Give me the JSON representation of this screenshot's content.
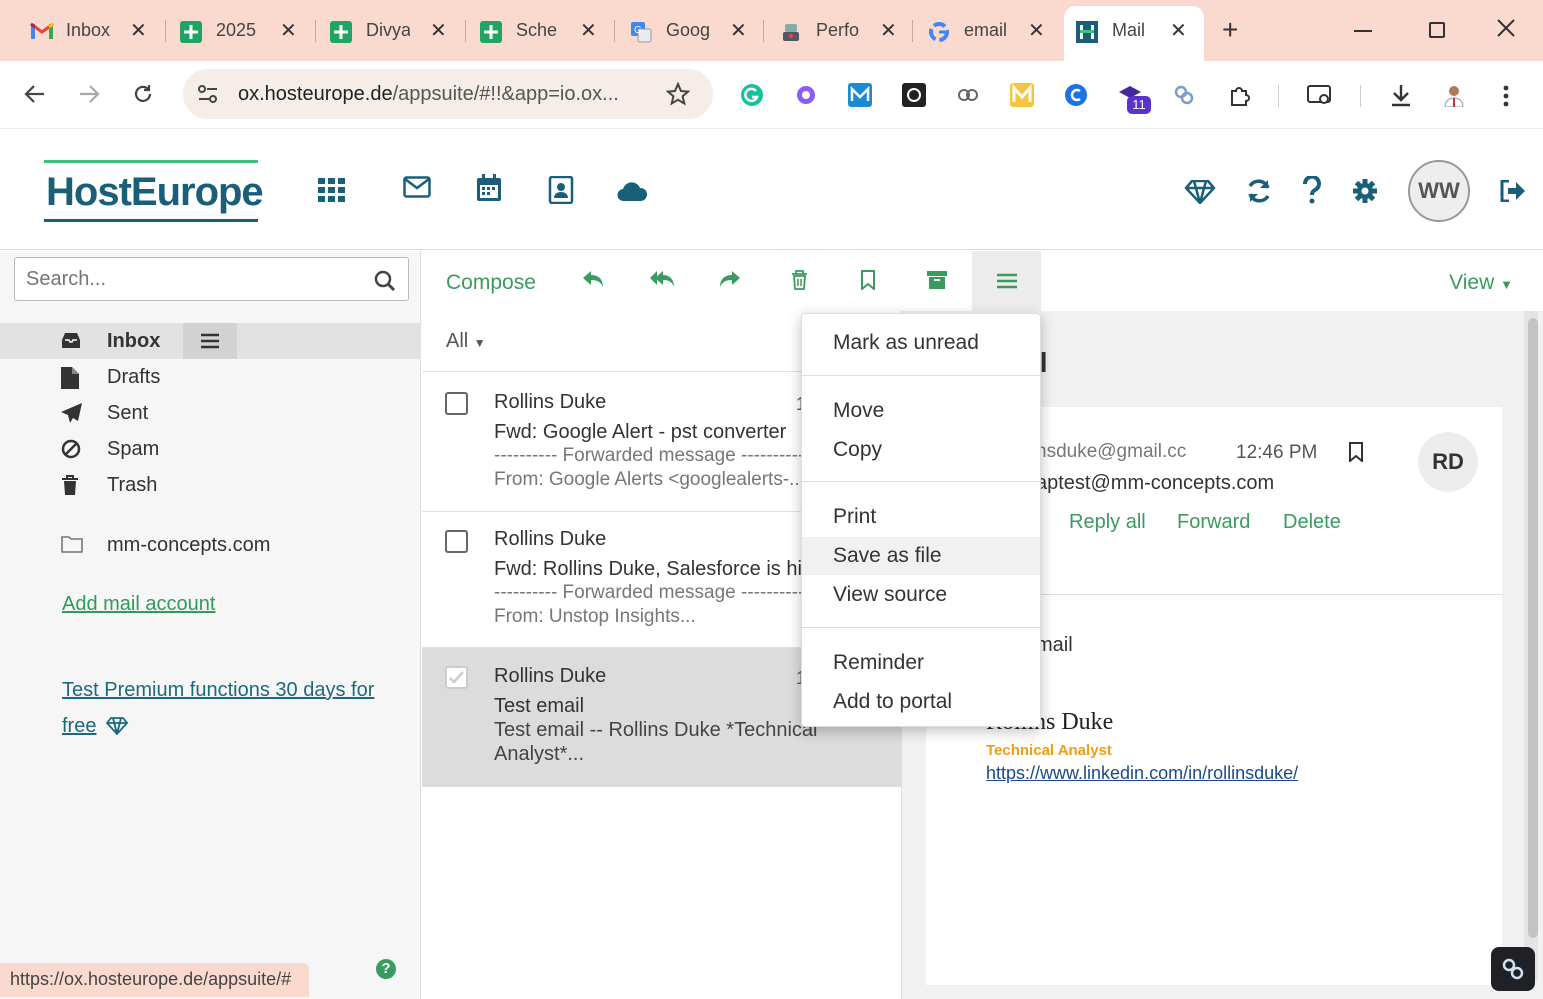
{
  "browser": {
    "tabs": [
      {
        "label": "Inbox",
        "icon": "gmail-icon"
      },
      {
        "label": "2025",
        "icon": "sheets-icon"
      },
      {
        "label": "Divya",
        "icon": "sheets-icon"
      },
      {
        "label": "Sche",
        "icon": "sheets-icon"
      },
      {
        "label": "Goog",
        "icon": "translate-icon"
      },
      {
        "label": "Perfo",
        "icon": "performance-icon"
      },
      {
        "label": "email",
        "icon": "google-icon"
      },
      {
        "label": "Mail",
        "icon": "hosteurope-icon"
      }
    ],
    "close_glyph": "✕",
    "new_tab_glyph": "+",
    "url_domain": "ox.hosteurope.de",
    "url_path": "/appsuite/#!!&app=io.ox...",
    "extension_badge": "11",
    "status_url": "https://ox.hosteurope.de/appsuite/#"
  },
  "app": {
    "logo_text": "HostEurope",
    "avatar_initials": "WW",
    "brand_color": "#1a5f7a"
  },
  "sidebar": {
    "search_placeholder": "Search...",
    "folders": [
      {
        "label": "Inbox",
        "icon": "inbox-icon"
      },
      {
        "label": "Drafts",
        "icon": "drafts-icon"
      },
      {
        "label": "Sent",
        "icon": "sent-icon"
      },
      {
        "label": "Spam",
        "icon": "spam-icon"
      },
      {
        "label": "Trash",
        "icon": "trash-icon"
      }
    ],
    "account_folder": "mm-concepts.com",
    "add_account": "Add mail account",
    "premium_line1": "Test Premium functions 30 days for",
    "premium_line2": "free"
  },
  "toolbar": {
    "compose": "Compose",
    "view": "View"
  },
  "list": {
    "filter": "All",
    "messages": [
      {
        "from": "Rollins Duke",
        "date_fragment": "1",
        "subject": "Fwd: Google Alert - pst converter",
        "preview1": "---------- Forwarded message ----------",
        "preview2": "From: Google Alerts <googlealerts-..."
      },
      {
        "from": "Rollins Duke",
        "date_fragment": "",
        "subject": "Fwd: Rollins Duke, Salesforce is hiring",
        "preview1": "---------- Forwarded message ----------",
        "preview2": "From: Unstop Insights..."
      },
      {
        "from": "Rollins Duke",
        "date_fragment": "1",
        "subject": "Test email",
        "preview1": "Test email -- Rollins Duke *Technical",
        "preview2": "Analyst*..."
      }
    ]
  },
  "reading": {
    "title_fragment": "il",
    "from_fragment": "nsduke@gmail.cc",
    "time": "12:46 PM",
    "to_fragment": "aptest@mm-concepts.com",
    "avatar": "RD",
    "actions": [
      "Reply all",
      "Forward",
      "Delete"
    ],
    "body_fragment": "mail",
    "sig_name": "Rollins Duke",
    "sig_title": "Technical Analyst",
    "sig_link": "https://www.linkedin.com/in/rollinsduke/"
  },
  "context_menu": {
    "items": [
      "Mark as unread",
      "Move",
      "Copy",
      "Print",
      "Save as file",
      "View source",
      "Reminder",
      "Add to portal"
    ],
    "highlighted": "Save as file"
  }
}
